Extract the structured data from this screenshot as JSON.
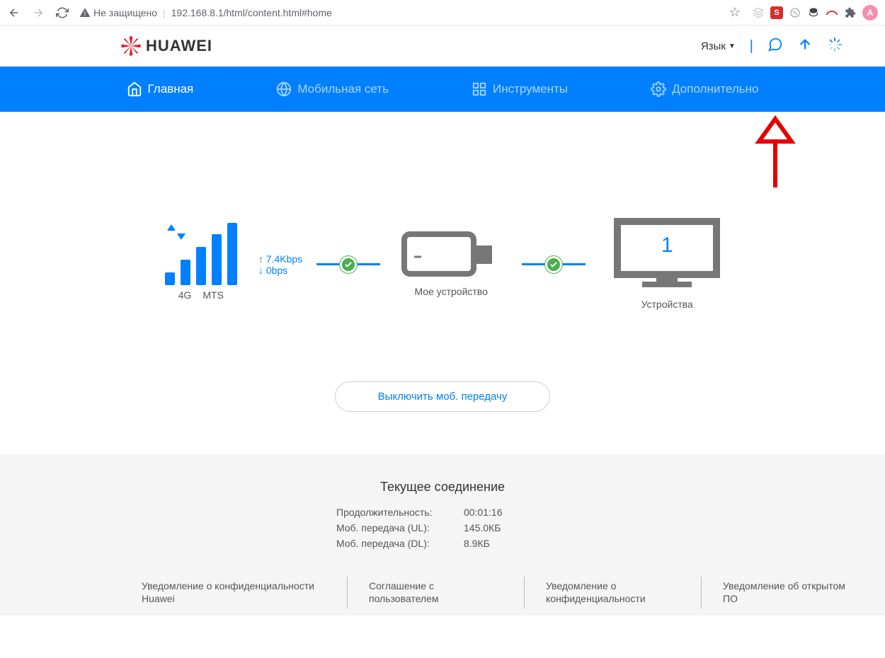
{
  "chrome": {
    "not_secure": "Не защищено",
    "url": "192.168.8.1/html/content.html#home",
    "avatar_letter": "A"
  },
  "header": {
    "brand": "HUAWEI",
    "language_label": "Язык"
  },
  "nav": {
    "home": "Главная",
    "mobile": "Мобильная сеть",
    "tools": "Инструменты",
    "advanced": "Дополнительно"
  },
  "signal": {
    "network_type": "4G",
    "operator": "MTS"
  },
  "speed": {
    "upload": "7.4Kbps",
    "download": "0bps"
  },
  "device": {
    "label": "Мое устройство"
  },
  "monitor": {
    "count": "1",
    "label": "Устройства"
  },
  "action_button": "Выключить моб. передачу",
  "connection": {
    "title": "Текущее соединение",
    "duration_label": "Продолжительность:",
    "duration_value": "00:01:16",
    "ul_label": "Моб. передача (UL):",
    "ul_value": "145.0КБ",
    "dl_label": "Моб. передача (DL):",
    "dl_value": "8.9КБ"
  },
  "footer": {
    "privacy": "Уведомление о конфиденциальности Huawei",
    "agreement": "Соглашение с пользователем",
    "confidentiality": "Уведомление о конфиденциальности",
    "opensource": "Уведомление об открытом ПО"
  }
}
